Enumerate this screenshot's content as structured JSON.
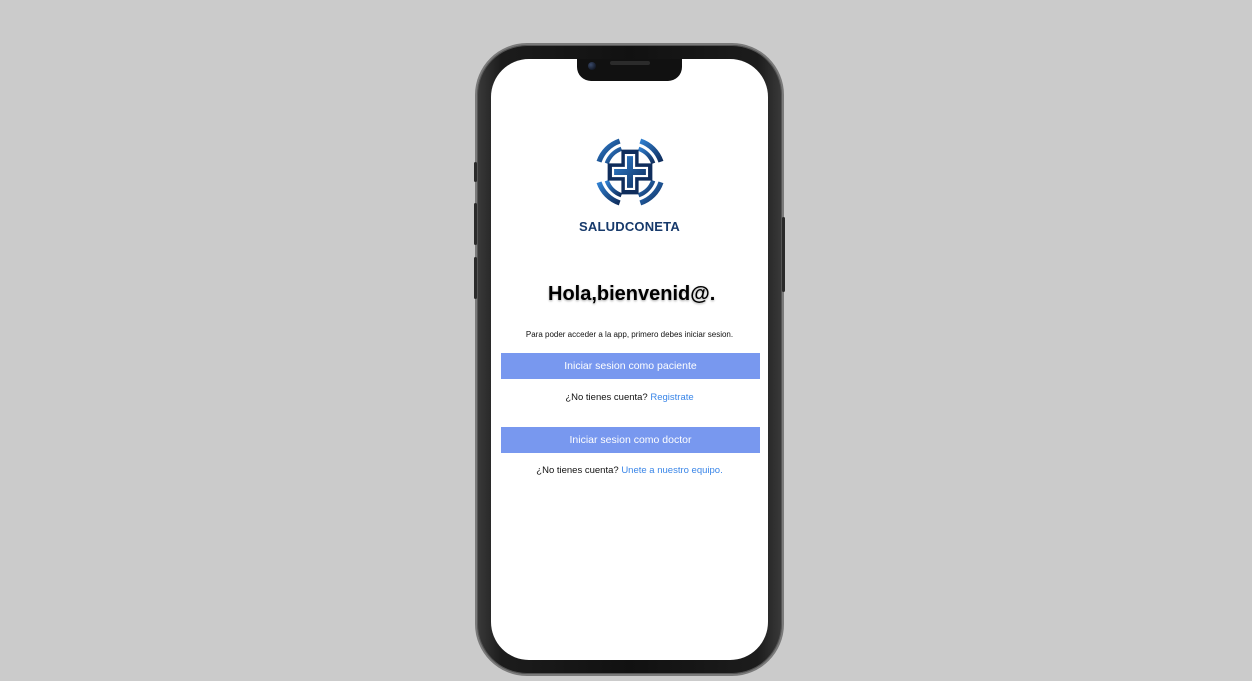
{
  "app": {
    "brand_name": "SALUDCONETA",
    "accent_color": "#7898ef",
    "brand_color": "#173a6b",
    "link_color": "#3a86e8"
  },
  "welcome": {
    "title": "Hola,bienvenid@.",
    "subtitle": "Para poder acceder a la app, primero debes iniciar sesion."
  },
  "patient": {
    "button_label": "Iniciar sesion como paciente",
    "prompt": "¿No tienes cuenta?",
    "link_label": "Registrate"
  },
  "doctor": {
    "button_label": "Iniciar sesion como doctor",
    "prompt": "¿No tienes cuenta?",
    "link_label": "Unete a nuestro equipo."
  },
  "icons": {
    "logo": "medical-cross-logo-icon",
    "camera": "front-camera-icon"
  }
}
